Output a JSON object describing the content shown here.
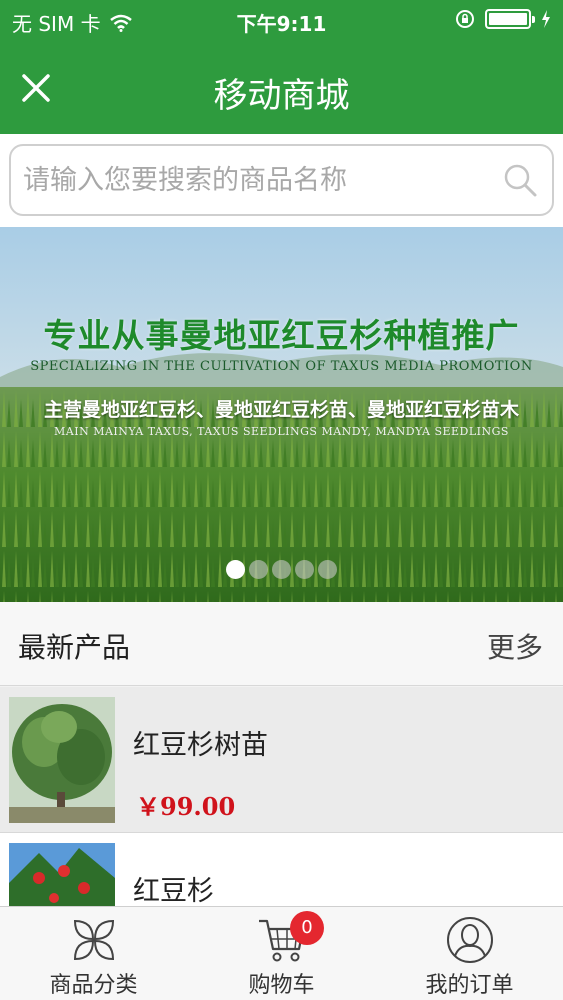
{
  "status_bar": {
    "carrier": "无 SIM 卡",
    "time": "下午9:11",
    "battery_level": 1.0
  },
  "nav": {
    "title": "移动商城",
    "close_icon": "close-icon"
  },
  "search": {
    "placeholder": "请输入您要搜索的商品名称",
    "value": "",
    "icon": "search-icon"
  },
  "banner": {
    "title": "专业从事曼地亚红豆杉种植推广",
    "subtitle": "SPECIALIZING IN THE CULTIVATION OF TAXUS MEDIA PROMOTION",
    "line2": "主营曼地亚红豆杉、曼地亚红豆杉苗、曼地亚红豆杉苗木",
    "line3": "MAIN MAINYA TAXUS, TAXUS SEEDLINGS MANDY, MANDYA SEEDLINGS",
    "slide_count": 5,
    "active_slide": 1
  },
  "latest": {
    "title": "最新产品",
    "more": "更多"
  },
  "products": [
    {
      "name": "红豆杉树苗",
      "price": "￥99.00"
    },
    {
      "name": "红豆杉",
      "price": ""
    }
  ],
  "tabs": [
    {
      "label": "商品分类",
      "icon": "category-icon"
    },
    {
      "label": "购物车",
      "icon": "cart-icon",
      "badge": "0"
    },
    {
      "label": "我的订单",
      "icon": "user-icon"
    }
  ],
  "colors": {
    "brand_green": "#2e9b3e",
    "price_red": "#d0121b",
    "badge_red": "#e4272f"
  }
}
